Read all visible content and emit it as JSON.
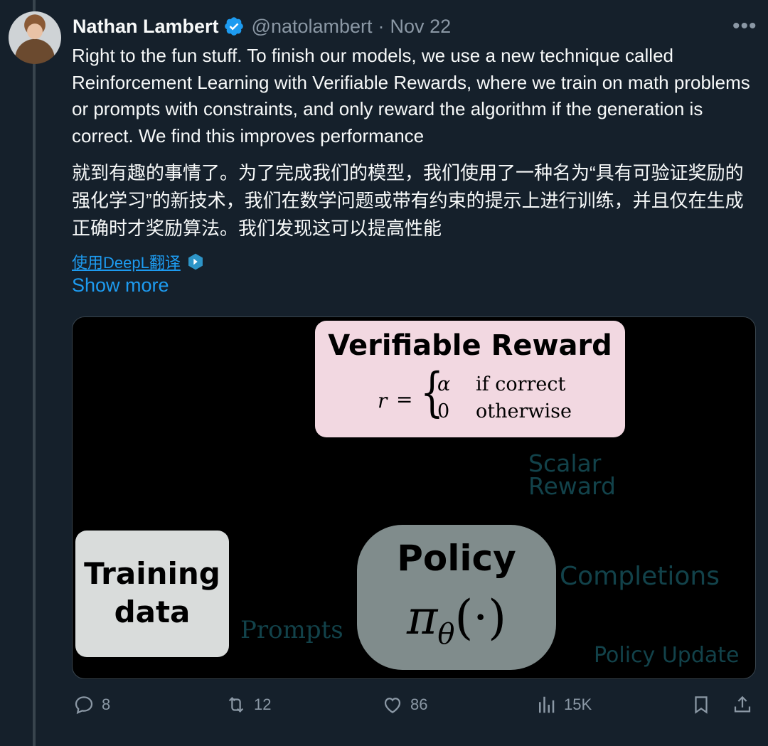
{
  "tweet": {
    "author_name": "Nathan Lambert",
    "handle": "@natolambert",
    "separator": "·",
    "date": "Nov 22",
    "more_icon": "more-horizontal-icon",
    "text_en": "Right to the fun stuff. To finish our models, we use a new technique called Reinforcement Learning with Verifiable Rewards, where we train on math problems or prompts with constraints, and only reward the algorithm if the generation is correct. We find this improves performance",
    "text_zh": "就到有趣的事情了。为了完成我们的模型，我们使用了一种名为“具有可验证奖励的强化学习”的新技术，我们在数学问题或带有约束的提示上进行训练，并且仅在生成正确时才奖励算法。我们发现这可以提高性能",
    "translate_label": "使用DeepL翻译",
    "show_more": "Show more"
  },
  "media": {
    "vr_title": "Verifiable Reward",
    "formula": {
      "lhs": "r",
      "eq": "=",
      "case1_value": "α",
      "case1_cond": "if correct",
      "case2_value": "0",
      "case2_cond": "otherwise"
    },
    "scalar_reward": "Scalar\nReward",
    "completions": "Completions",
    "prompts": "Prompts",
    "policy_update": "Policy Update",
    "training_data": "Training\ndata",
    "policy_title": "Policy",
    "policy_symbol": "π",
    "policy_subscript": "θ",
    "policy_arg": "(·)"
  },
  "actions": {
    "replies": "8",
    "reposts": "12",
    "likes": "86",
    "views": "15K"
  },
  "colors": {
    "background": "#15202b",
    "accent": "#1d9bf0",
    "muted": "#8b98a5",
    "diagram_label": "#12424a",
    "verifiable_reward_box": "#f2d8e1",
    "training_box": "#d9dcdb",
    "policy_box": "#808c8c"
  }
}
